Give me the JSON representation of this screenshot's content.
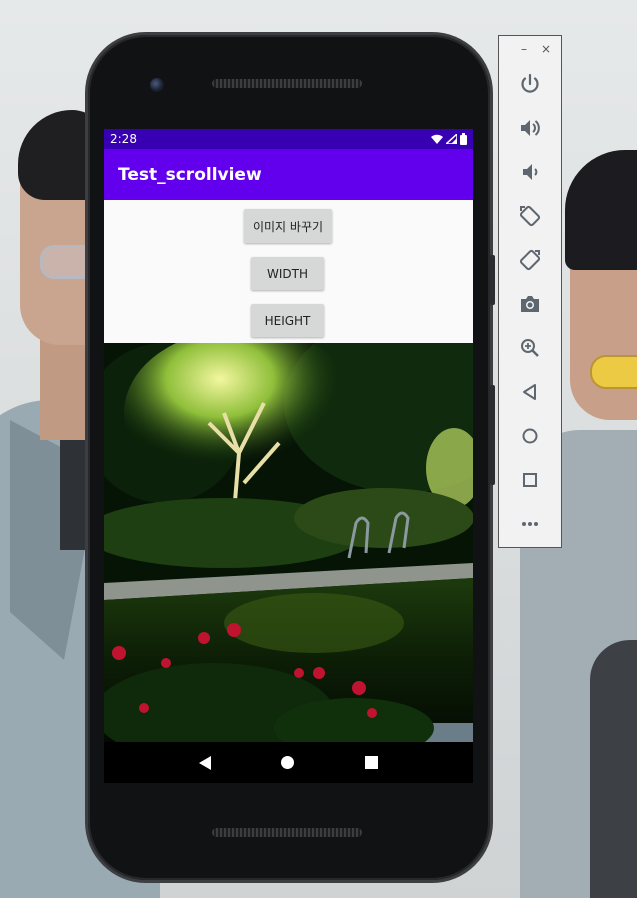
{
  "phone": {
    "status_bar": {
      "time": "2:28"
    },
    "app_bar": {
      "title": "Test_scrollview"
    },
    "buttons": {
      "change_image": "이미지 바꾸기",
      "width": "WIDTH",
      "height": "HEIGHT"
    },
    "image": {
      "description_icon": "garden-photo"
    },
    "nav_bar": {
      "items": [
        "back-icon",
        "home-icon",
        "recents-icon"
      ]
    }
  },
  "emulator_toolbar": {
    "window_controls": {
      "minimize": "–",
      "close": "×"
    },
    "items": [
      "power-icon",
      "volume-up-icon",
      "volume-down-icon",
      "rotate-left-icon",
      "rotate-right-icon",
      "camera-icon",
      "zoom-icon",
      "back-icon",
      "home-icon",
      "overview-icon",
      "more-icon"
    ]
  },
  "colors": {
    "status_bar": "#3700b3",
    "app_bar": "#6200ee",
    "button_bg": "#d6d7d7",
    "content_bg": "#fafafa"
  }
}
